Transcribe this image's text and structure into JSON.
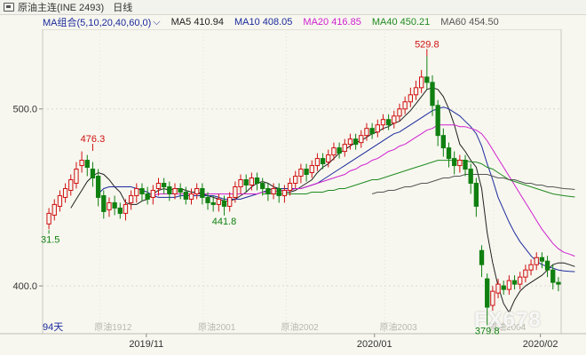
{
  "window": {
    "title": "原油主连(INE 2493)",
    "period": "日线"
  },
  "ma_bar": {
    "group_label": "MA组合(5,10,20,40,60,0)",
    "chevron": "chevron-down-icon",
    "items": [
      {
        "label": "MA5 410.94",
        "color": "#202020"
      },
      {
        "label": "MA10 408.05",
        "color": "#1c2a9c"
      },
      {
        "label": "MA20 416.85",
        "color": "#d020d0"
      },
      {
        "label": "MA40 450.21",
        "color": "#208a20"
      },
      {
        "label": "MA60 454.50",
        "color": "#555555"
      }
    ]
  },
  "chart_data": {
    "type": "candlestick",
    "y_ticks": [
      {
        "value": 500,
        "label": "500.0"
      },
      {
        "value": 400,
        "label": "400.0"
      }
    ],
    "ylim": [
      373,
      545
    ],
    "x_dates": [
      {
        "label": "2019/11",
        "pos": 0.2
      },
      {
        "label": "2020/01",
        "pos": 0.64
      },
      {
        "label": "2020/02",
        "pos": 0.96
      }
    ],
    "contract_labels": [
      {
        "label": "原油1912",
        "pos": 0.11
      },
      {
        "label": "原油2001",
        "pos": 0.31
      },
      {
        "label": "原油2002",
        "pos": 0.47
      },
      {
        "label": "原油2003",
        "pos": 0.66
      },
      {
        "label": "原油2004",
        "pos": 0.87
      }
    ],
    "bottom_left_label": "94天",
    "annotations": [
      {
        "text": "476.3",
        "value": 476.3,
        "index": 8,
        "color": "#d01010"
      },
      {
        "text": "31.5",
        "value": 431.5,
        "index": 0,
        "color": "#108010"
      },
      {
        "text": "441.8",
        "value": 441.8,
        "index": 32,
        "color": "#108010"
      },
      {
        "text": "529.8",
        "value": 529.8,
        "index": 69,
        "color": "#d01010"
      },
      {
        "text": "379.8",
        "value": 379.8,
        "index": 80,
        "color": "#108010"
      }
    ],
    "candles": [
      [
        435,
        441,
        432,
        444
      ],
      [
        440,
        446,
        437,
        449
      ],
      [
        445,
        451,
        442,
        454
      ],
      [
        450,
        455,
        447,
        458
      ],
      [
        454,
        460,
        451,
        463
      ],
      [
        458,
        466,
        455,
        470
      ],
      [
        468,
        471,
        464,
        476
      ],
      [
        471,
        467,
        462,
        474
      ],
      [
        466,
        461,
        456,
        470
      ],
      [
        462,
        450,
        445,
        466
      ],
      [
        451,
        442,
        438,
        454
      ],
      [
        443,
        447,
        439,
        450
      ],
      [
        447,
        444,
        440,
        451
      ],
      [
        444,
        441,
        438,
        447
      ],
      [
        441,
        446,
        437,
        449
      ],
      [
        447,
        451,
        443,
        454
      ],
      [
        451,
        455,
        447,
        458
      ],
      [
        455,
        452,
        448,
        458
      ],
      [
        452,
        449,
        446,
        456
      ],
      [
        450,
        454,
        446,
        457
      ],
      [
        455,
        458,
        451,
        461
      ],
      [
        458,
        456,
        452,
        461
      ],
      [
        456,
        452,
        448,
        459
      ],
      [
        452,
        455,
        449,
        458
      ],
      [
        455,
        453,
        449,
        458
      ],
      [
        453,
        449,
        446,
        456
      ],
      [
        449,
        452,
        446,
        455
      ],
      [
        452,
        455,
        449,
        458
      ],
      [
        455,
        450,
        446,
        458
      ],
      [
        450,
        447,
        443,
        453
      ],
      [
        447,
        446,
        442,
        451
      ],
      [
        446,
        449,
        442,
        452
      ],
      [
        448,
        445,
        441.8,
        451
      ],
      [
        445,
        450,
        442,
        453
      ],
      [
        450,
        456,
        447,
        459
      ],
      [
        456,
        460,
        452,
        463
      ],
      [
        460,
        457,
        453,
        463
      ],
      [
        457,
        461,
        454,
        464
      ],
      [
        461,
        458,
        454,
        464
      ],
      [
        458,
        455,
        451,
        461
      ],
      [
        455,
        452,
        448,
        458
      ],
      [
        452,
        455,
        449,
        458
      ],
      [
        455,
        451,
        447,
        458
      ],
      [
        451,
        454,
        447,
        457
      ],
      [
        454,
        458,
        451,
        461
      ],
      [
        458,
        462,
        455,
        465
      ],
      [
        462,
        466,
        458,
        469
      ],
      [
        466,
        463,
        459,
        469
      ],
      [
        464,
        468,
        461,
        471
      ],
      [
        468,
        472,
        465,
        475
      ],
      [
        472,
        469,
        466,
        475
      ],
      [
        470,
        474,
        467,
        477
      ],
      [
        474,
        478,
        471,
        481
      ],
      [
        478,
        475,
        472,
        481
      ],
      [
        476,
        480,
        473,
        483
      ],
      [
        480,
        483,
        477,
        486
      ],
      [
        483,
        480,
        477,
        486
      ],
      [
        481,
        485,
        478,
        488
      ],
      [
        485,
        489,
        482,
        492
      ],
      [
        489,
        486,
        483,
        492
      ],
      [
        487,
        491,
        484,
        494
      ],
      [
        491,
        494,
        488,
        497
      ],
      [
        494,
        491,
        488,
        497
      ],
      [
        492,
        496,
        489,
        499
      ],
      [
        496,
        500,
        493,
        503
      ],
      [
        500,
        504,
        497,
        507
      ],
      [
        504,
        508,
        501,
        512
      ],
      [
        508,
        512,
        505,
        516
      ],
      [
        512,
        518,
        509,
        522
      ],
      [
        518,
        515,
        511,
        529.8
      ],
      [
        515,
        502,
        496,
        519
      ],
      [
        502,
        485,
        479,
        505
      ],
      [
        485,
        478,
        473,
        489
      ],
      [
        478,
        472,
        467,
        481
      ],
      [
        472,
        468,
        463,
        476
      ],
      [
        468,
        471,
        464,
        474
      ],
      [
        471,
        466,
        462,
        474
      ],
      [
        466,
        458,
        452,
        469
      ],
      [
        458,
        445,
        439,
        461
      ],
      [
        420,
        412,
        405,
        423
      ],
      [
        404,
        388,
        379.8,
        407
      ],
      [
        389,
        397,
        386,
        400
      ],
      [
        396,
        401,
        393,
        404
      ],
      [
        400,
        398,
        395,
        403
      ],
      [
        398,
        403,
        395,
        406
      ],
      [
        403,
        401,
        398,
        406
      ],
      [
        401,
        405,
        398,
        408
      ],
      [
        405,
        409,
        402,
        412
      ],
      [
        409,
        412,
        406,
        415
      ],
      [
        412,
        416,
        409,
        419
      ],
      [
        416,
        414,
        410,
        419
      ],
      [
        414,
        409,
        405,
        417
      ],
      [
        409,
        402,
        398,
        412
      ],
      [
        402,
        401,
        397,
        405
      ]
    ],
    "ma_series": [
      {
        "name": "MA5",
        "color": "#202020",
        "values": [
          null,
          null,
          null,
          null,
          444,
          449,
          454,
          459,
          462,
          464,
          463,
          460,
          456,
          453,
          447,
          446,
          446,
          448,
          449,
          452,
          454,
          455,
          454,
          455,
          455,
          454,
          453,
          453,
          452,
          451,
          450,
          449,
          448,
          448,
          449,
          451,
          453,
          456,
          458,
          459,
          458,
          456,
          455,
          453,
          453,
          454,
          456,
          458,
          460,
          464,
          467,
          469,
          472,
          475,
          477,
          479,
          481,
          482,
          484,
          486,
          487,
          489,
          490,
          492,
          493,
          496,
          499,
          503,
          507,
          511,
          512,
          511,
          507,
          500,
          491,
          480,
          476,
          471,
          467,
          455,
          430,
          413,
          400,
          390,
          385,
          392,
          397,
          400,
          402,
          404,
          406,
          409,
          412,
          413,
          413,
          412,
          410.94
        ]
      },
      {
        "name": "MA10",
        "color": "#1c2a9c",
        "values": [
          null,
          null,
          null,
          null,
          null,
          null,
          null,
          null,
          null,
          452,
          455,
          456,
          456,
          456,
          456,
          456,
          455,
          454,
          453,
          451,
          450,
          450,
          450,
          450,
          451,
          451,
          451,
          451,
          451,
          451,
          451,
          450,
          449,
          449,
          449,
          449,
          450,
          451,
          452,
          453,
          454,
          455,
          455,
          455,
          455,
          455,
          455,
          456,
          457,
          458,
          460,
          462,
          464,
          466,
          468,
          470,
          472,
          474,
          476,
          478,
          480,
          482,
          484,
          486,
          487,
          489,
          491,
          493,
          495,
          497,
          499,
          500,
          501,
          500,
          498,
          496,
          493,
          490,
          486,
          479,
          469,
          460,
          450,
          443,
          436,
          430,
          425,
          421,
          417,
          414,
          412,
          411,
          410,
          409,
          408.5,
          408.2,
          408.05
        ]
      },
      {
        "name": "MA20",
        "color": "#d020d0",
        "values": [
          null,
          null,
          null,
          null,
          null,
          null,
          null,
          null,
          null,
          null,
          null,
          null,
          null,
          null,
          null,
          null,
          null,
          null,
          null,
          451,
          452,
          452,
          452,
          452,
          452,
          452,
          452,
          452,
          452,
          452,
          452,
          452,
          452,
          452,
          452,
          452,
          452,
          452,
          452,
          453,
          453,
          453,
          454,
          454,
          454,
          455,
          455,
          456,
          457,
          458,
          459,
          460,
          461,
          462,
          463,
          465,
          466,
          468,
          469,
          471,
          472,
          474,
          476,
          477,
          479,
          480,
          482,
          484,
          486,
          488,
          489,
          491,
          491,
          491,
          491,
          490,
          490,
          489,
          488,
          486,
          482,
          477,
          472,
          467,
          462,
          457,
          452,
          447,
          442,
          437,
          432,
          428,
          424,
          421,
          419,
          418,
          416.85
        ]
      },
      {
        "name": "MA40",
        "color": "#208a20",
        "values": [
          null,
          null,
          null,
          null,
          null,
          null,
          null,
          null,
          null,
          null,
          null,
          null,
          null,
          null,
          null,
          null,
          null,
          null,
          null,
          null,
          null,
          null,
          null,
          null,
          null,
          null,
          null,
          null,
          null,
          null,
          null,
          null,
          null,
          null,
          null,
          null,
          null,
          null,
          null,
          452,
          452,
          452,
          452,
          452,
          452,
          452,
          452,
          452,
          453,
          453,
          453,
          454,
          454,
          455,
          455,
          456,
          457,
          458,
          459,
          460,
          460,
          461,
          462,
          463,
          464,
          465,
          466,
          467,
          468,
          469,
          470,
          471,
          471,
          471,
          471,
          471,
          471,
          470,
          470,
          469,
          467,
          466,
          464,
          462,
          460,
          459,
          458,
          457,
          456,
          455,
          454,
          453,
          452,
          451.5,
          451,
          450.6,
          450.21
        ]
      },
      {
        "name": "MA60",
        "color": "#555555",
        "values": [
          null,
          null,
          null,
          null,
          null,
          null,
          null,
          null,
          null,
          null,
          null,
          null,
          null,
          null,
          null,
          null,
          null,
          null,
          null,
          null,
          null,
          null,
          null,
          null,
          null,
          null,
          null,
          null,
          null,
          null,
          null,
          null,
          null,
          null,
          null,
          null,
          null,
          null,
          null,
          null,
          null,
          null,
          null,
          null,
          null,
          null,
          null,
          null,
          null,
          null,
          null,
          null,
          null,
          null,
          null,
          null,
          null,
          null,
          null,
          452,
          453,
          453,
          454,
          454,
          455,
          456,
          456,
          457,
          458,
          458,
          459,
          460,
          461,
          461,
          462,
          462,
          463,
          463,
          463,
          463,
          463,
          462,
          461,
          461,
          460,
          460,
          459,
          458,
          458,
          457,
          457,
          456,
          456,
          455.5,
          455,
          454.8,
          454.5
        ]
      }
    ]
  }
}
